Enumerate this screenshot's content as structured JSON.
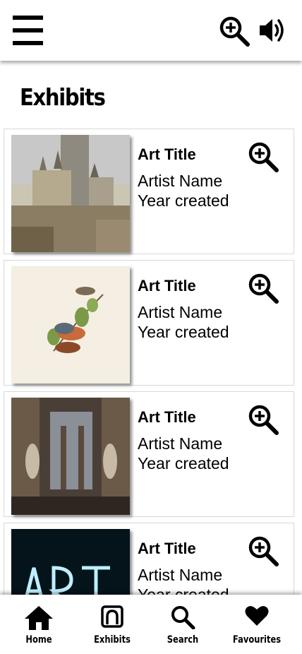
{
  "header": {
    "menu_icon": "hamburger-menu-icon",
    "zoom_icon": "zoom-in-icon",
    "sound_icon": "speaker-volume-icon"
  },
  "page": {
    "title": "Exhibits"
  },
  "exhibits": [
    {
      "image": "castle-painting",
      "title": "Art Title",
      "artist": "Artist Name",
      "year": "Year created",
      "zoom_icon": "zoom-in-icon"
    },
    {
      "image": "bird-illustration",
      "title": "Art Title",
      "artist": "Artist Name",
      "year": "Year created",
      "zoom_icon": "zoom-in-icon"
    },
    {
      "image": "cathedral-interior-painting",
      "title": "Art Title",
      "artist": "Artist Name",
      "year": "Year created",
      "zoom_icon": "zoom-in-icon"
    },
    {
      "image": "neon-art-sign",
      "title": "Art Title",
      "artist": "Artist Name",
      "year": "Year created",
      "zoom_icon": "zoom-in-icon"
    }
  ],
  "bottom_nav": {
    "items": [
      {
        "label": "Home",
        "icon": "home-icon"
      },
      {
        "label": "Exhibits",
        "icon": "exhibits-icon"
      },
      {
        "label": "Search",
        "icon": "search-icon"
      },
      {
        "label": "Favourites",
        "icon": "heart-icon"
      }
    ]
  },
  "colors": {
    "background": "#ffffff",
    "text": "#000000",
    "card_border": "#d9d9d9"
  }
}
